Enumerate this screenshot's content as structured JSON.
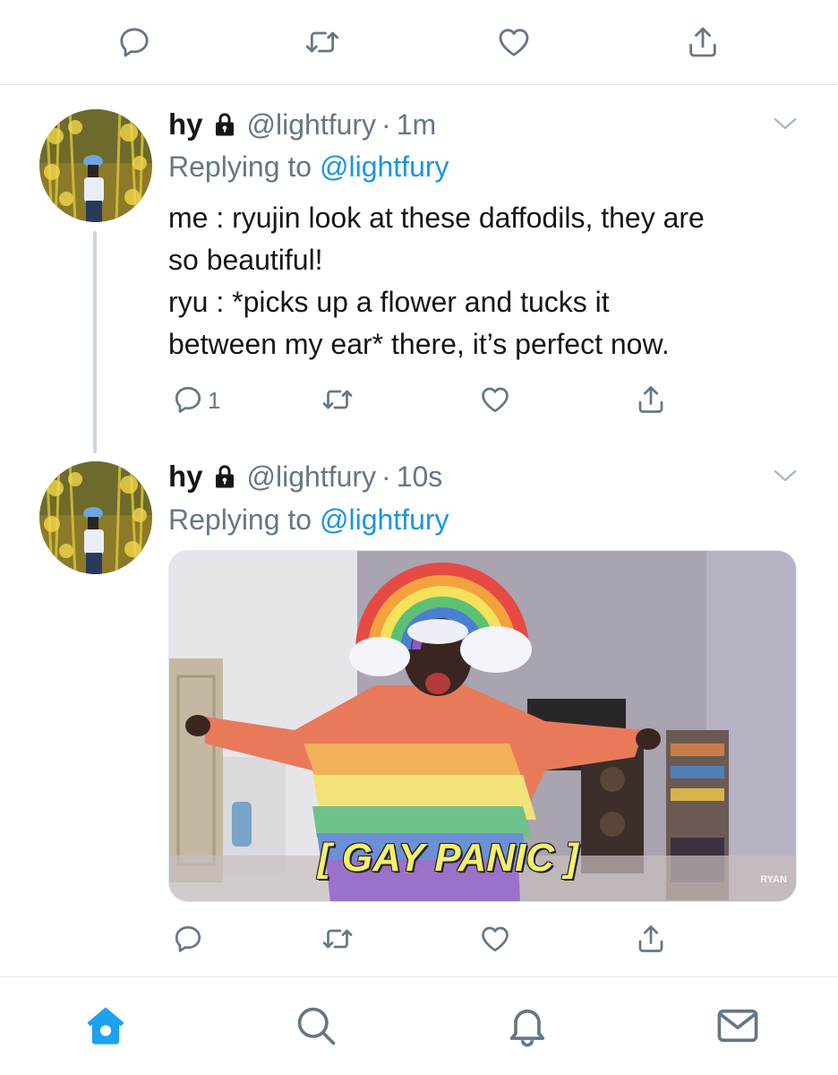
{
  "top_actions": {
    "icons": [
      "reply-icon",
      "retweet-icon",
      "like-icon",
      "share-icon"
    ]
  },
  "tweets": [
    {
      "name": "hy",
      "handle": "@lightfury",
      "separator": "·",
      "time": "1m",
      "replying_prefix": "Replying to",
      "replying_to": "@lightfury",
      "text_lines": [
        "me : ryujin look at these daffodils, they are",
        "so beautiful!",
        "ryu : *picks up a flower and tucks it",
        "between my ear* there, it’s perfect now."
      ],
      "reply_count": "1"
    },
    {
      "name": "hy",
      "handle": "@lightfury",
      "separator": "·",
      "time": "10s",
      "replying_prefix": "Replying to",
      "replying_to": "@lightfury",
      "media": {
        "caption": "[ GAY PANIC ]",
        "watermark": "RYAN"
      }
    }
  ],
  "tab_bar": {
    "icons": [
      "home-icon",
      "search-icon",
      "notifications-icon",
      "messages-icon"
    ],
    "active": "home-icon"
  },
  "colors": {
    "accent": "#1da1f2",
    "link": "#1b95e0",
    "secondary_text": "#657786",
    "divider": "#e1e8ed",
    "thread_line": "#ccd6dd"
  }
}
